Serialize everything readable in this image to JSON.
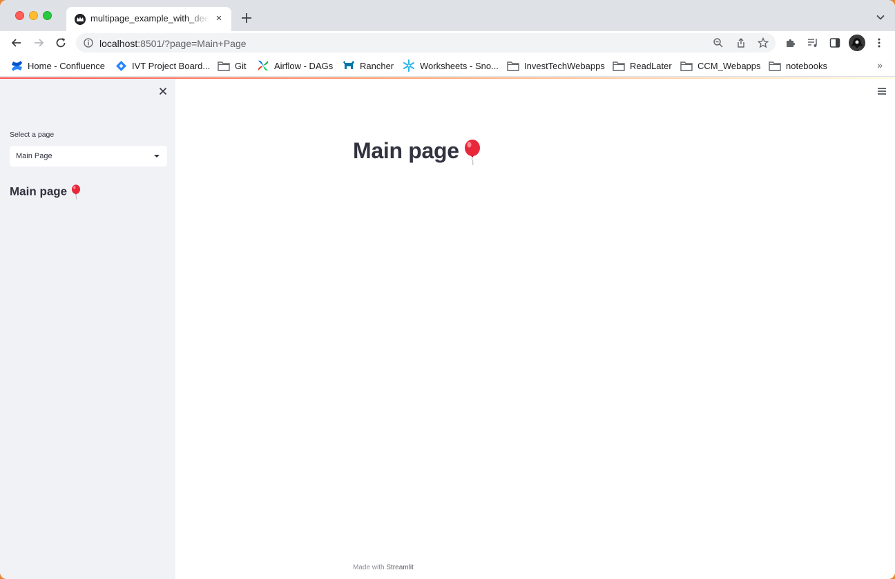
{
  "browser": {
    "tab": {
      "title": "multipage_example_with_deep_links",
      "close_label": "×"
    },
    "address_bar": {
      "host": "localhost",
      "rest": ":8501/?page=Main+Page"
    },
    "bookmarks": [
      {
        "label": "Home - Confluence",
        "icon": "confluence-icon"
      },
      {
        "label": "IVT Project Board...",
        "icon": "jira-icon"
      },
      {
        "label": "Git",
        "icon": "folder-icon"
      },
      {
        "label": "Airflow - DAGs",
        "icon": "airflow-icon"
      },
      {
        "label": "Rancher",
        "icon": "rancher-icon"
      },
      {
        "label": "Worksheets - Sno...",
        "icon": "snowflake-icon"
      },
      {
        "label": "InvestTechWebapps",
        "icon": "folder-icon"
      },
      {
        "label": "ReadLater",
        "icon": "folder-icon"
      },
      {
        "label": "CCM_Webapps",
        "icon": "folder-icon"
      },
      {
        "label": "notebooks",
        "icon": "folder-icon"
      }
    ],
    "bookmarks_overflow": "»"
  },
  "sidebar": {
    "select_label": "Select a page",
    "select_value": "Main Page",
    "heading": "Main page"
  },
  "main": {
    "title": "Main page"
  },
  "footer": {
    "prefix": "Made with ",
    "brand": "Streamlit"
  }
}
